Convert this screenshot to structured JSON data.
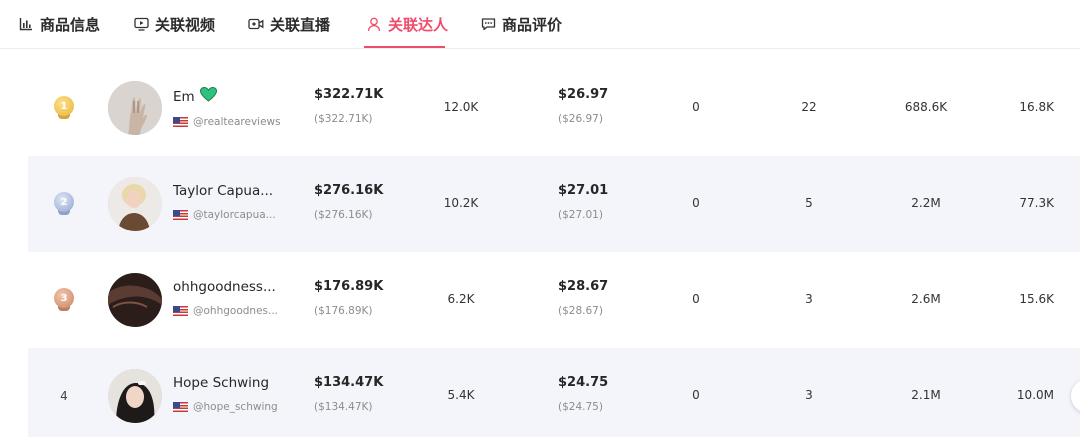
{
  "tabs": [
    {
      "label": "商品信息",
      "icon": "bar-chart-icon"
    },
    {
      "label": "关联视频",
      "icon": "video-screen-icon"
    },
    {
      "label": "关联直播",
      "icon": "live-camera-icon"
    },
    {
      "label": "关联达人",
      "icon": "person-icon",
      "active": true
    },
    {
      "label": "商品评价",
      "icon": "comment-icon"
    }
  ],
  "colors": {
    "accent": "#ee4d6a",
    "row_shade": "#f4f5fb",
    "heart": "#2ec27e"
  },
  "creators": [
    {
      "rank": "1",
      "medal": "gold",
      "name": "Em",
      "badge": "green-heart-icon",
      "handle": "@realteareviews",
      "revenue": "$322.71K",
      "revenue_sub": "($322.71K)",
      "sales": "12.0K",
      "avg_price": "$26.97",
      "avg_price_sub": "($26.97)",
      "col5": "0",
      "col6": "22",
      "followers": "688.6K",
      "col8": "16.8K"
    },
    {
      "rank": "2",
      "medal": "silver",
      "name": "Taylor Capua...",
      "handle": "@taylorcapua...",
      "revenue": "$276.16K",
      "revenue_sub": "($276.16K)",
      "sales": "10.2K",
      "avg_price": "$27.01",
      "avg_price_sub": "($27.01)",
      "col5": "0",
      "col6": "5",
      "followers": "2.2M",
      "col8": "77.3K"
    },
    {
      "rank": "3",
      "medal": "bronze",
      "name": "ohhgoodness...",
      "handle": "@ohhgoodnes...",
      "revenue": "$176.89K",
      "revenue_sub": "($176.89K)",
      "sales": "6.2K",
      "avg_price": "$28.67",
      "avg_price_sub": "($28.67)",
      "col5": "0",
      "col6": "3",
      "followers": "2.6M",
      "col8": "15.6K"
    },
    {
      "rank": "4",
      "medal": "",
      "name": "Hope Schwing",
      "handle": "@hope_schwing",
      "revenue": "$134.47K",
      "revenue_sub": "($134.47K)",
      "sales": "5.4K",
      "avg_price": "$24.75",
      "avg_price_sub": "($24.75)",
      "col5": "0",
      "col6": "3",
      "followers": "2.1M",
      "col8": "10.0M"
    }
  ]
}
